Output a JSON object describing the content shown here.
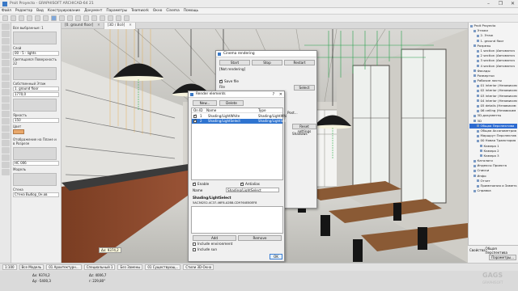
{
  "window": {
    "title": "Proit Proyecto - GRAPHISOFT ARCHICAD-64 21",
    "controls": [
      "–",
      "❐",
      "✕"
    ]
  },
  "menubar": [
    "Файл",
    "Редактор",
    "Вид",
    "Конструирование",
    "Документ",
    "Параметры",
    "Teamwork",
    "Окно",
    "Cinema",
    "Помощь"
  ],
  "tabs": [
    {
      "label": "[0. ground floor]",
      "close": "✕",
      "active": false
    },
    {
      "label": "[3D / Всё]",
      "close": "✕",
      "active": true
    }
  ],
  "infobox": {
    "title": "Все выбранные: 1",
    "layer_label": "Слой",
    "layer_value": "00 - 5 - lights",
    "surface_label": "Светящаяся Поверхность 22",
    "floor_label": "Собственный Этаж",
    "floor_value": "1. ground floor",
    "angle_value": "1770,0",
    "brightness_label": "Яркость",
    "brightness_value": "150",
    "color_label": "Цвет",
    "sun_label": "Отображение на Плане и в Разрезе",
    "model_label": "Модель",
    "element_id": "HC 006",
    "wall_label": "Стена",
    "wall_value": "Стена Выбор_0н.ов"
  },
  "view": {
    "coords_tooltip_x": "Δx: 9374,2",
    "coords_tooltip_y": "Δy: -5400,3",
    "coords_tooltip_z": "Δz: 4006,7",
    "coords_tooltip_r": "r: 229,80°",
    "zoom": "1:100"
  },
  "render_panel": {
    "title": "Cinema rendering",
    "start_label": "Start",
    "stop_label": "Stop",
    "restart_label": "Restart",
    "status_text": "[Not rendering]",
    "save_file_label": "Save file",
    "file_label": "File",
    "select_label": "Select",
    "mapping_label": "Mapping",
    "post_label": "Post...",
    "apply_label": "Reset settings",
    "shadows_label": "Shadows"
  },
  "dialog": {
    "title": "Render elements",
    "help": "?",
    "close": "✕",
    "new_label": "New...",
    "delete_label": "Delete",
    "col_on": "On",
    "col_id": "ID",
    "col_name": "Name",
    "col_type": "Type",
    "rows": [
      {
        "on": true,
        "id": "1",
        "name": "Shading/LightWhite",
        "type": "Shading/LightWhi",
        "selected": false
      },
      {
        "on": true,
        "id": "2",
        "name": "Shading/LightSelect",
        "type": "Shading/LightSel",
        "selected": true
      }
    ],
    "enable_label": "Enable",
    "antialias_label": "Antialias",
    "name_label": "Name",
    "name_value": "Shading/LightSelect",
    "section_label": "Shading/LightSelect",
    "guid": "5AC36252-4C37-46F8-A2B8-CD9764E80EF8",
    "add_label": "Add",
    "remove_label": "Remove",
    "include_env_label": "Include environment",
    "include_sun_label": "Include sun",
    "ok_label": "OK"
  },
  "navigator": {
    "items": [
      {
        "label": "Proit Proyecto",
        "depth": 0
      },
      {
        "label": "Этажи",
        "depth": 1
      },
      {
        "label": "2. Этаж",
        "depth": 2
      },
      {
        "label": "1. ground floor",
        "depth": 2
      },
      {
        "label": "Разрезы",
        "depth": 1
      },
      {
        "label": "1 section (Автоматич",
        "depth": 2
      },
      {
        "label": "2 section (Автоматич",
        "depth": 2
      },
      {
        "label": "3 section (Автоматич",
        "depth": 2
      },
      {
        "label": "4 section (Автоматич",
        "depth": 2
      },
      {
        "label": "Фасады",
        "depth": 1
      },
      {
        "label": "Развертки",
        "depth": 1
      },
      {
        "label": "Рабочие листы",
        "depth": 1
      },
      {
        "label": "01 interior (Независим",
        "depth": 2
      },
      {
        "label": "02 interior (Независим",
        "depth": 2
      },
      {
        "label": "03 interior (Независим",
        "depth": 2
      },
      {
        "label": "04 interior (Независим",
        "depth": 2
      },
      {
        "label": "05 details (Независим",
        "depth": 2
      },
      {
        "label": "06 ceiling (Независим",
        "depth": 2
      },
      {
        "label": "3D-документы",
        "depth": 1
      },
      {
        "label": "3D",
        "depth": 1
      },
      {
        "label": "Общая Перспектива",
        "depth": 2,
        "selected": true
      },
      {
        "label": "Общая Аксонометрия",
        "depth": 2
      },
      {
        "label": "Маршрут Перспектив",
        "depth": 2
      },
      {
        "label": "00 Новая Траектория",
        "depth": 2
      },
      {
        "label": "Камера 1",
        "depth": 3
      },
      {
        "label": "Камера 2",
        "depth": 3
      },
      {
        "label": "Камера 3",
        "depth": 3
      },
      {
        "label": "Каталоги",
        "depth": 1
      },
      {
        "label": "Индексы Проекта",
        "depth": 1
      },
      {
        "label": "Списки",
        "depth": 1
      },
      {
        "label": "Инфо",
        "depth": 1
      },
      {
        "label": "Отчет",
        "depth": 2
      },
      {
        "label": "Примечания и Заметки",
        "depth": 2
      },
      {
        "label": "Справка",
        "depth": 1
      }
    ],
    "properties_label": "Свойства",
    "properties_value": "Общая Перспектива",
    "params_label": "Параметры..."
  },
  "statusbar": [
    "Все Модель",
    "01 Архитектурн...",
    "Специальный 1",
    "Без Замены",
    "01 Существующ...",
    "Стили 3D-Окна"
  ],
  "watermark": {
    "brand": "GAGS",
    "sub": "GRAPHISOFT"
  }
}
